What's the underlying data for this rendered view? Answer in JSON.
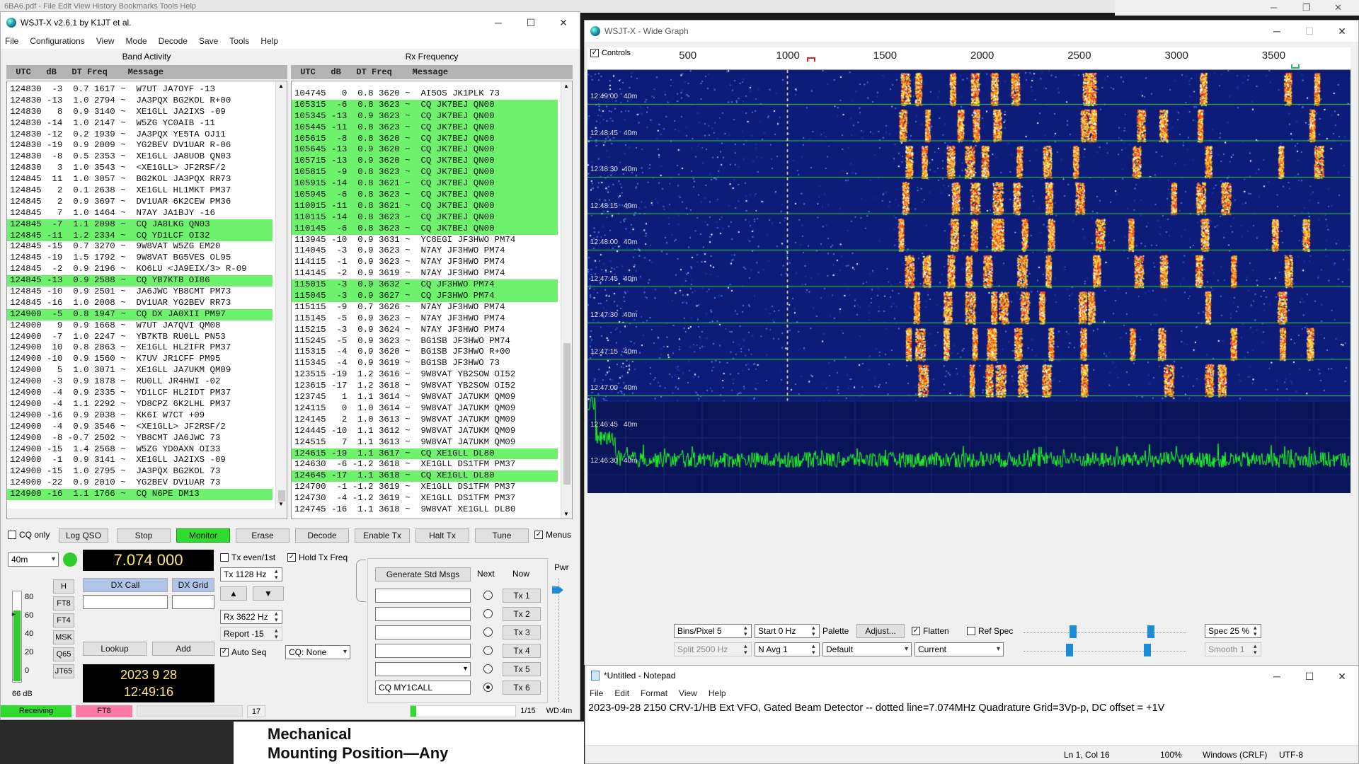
{
  "background_window": {
    "title": "6BA6.pdf - File  Edit  View  History  Bookmarks  Tools  Help"
  },
  "pdf": {
    "line1": "Mechanical",
    "line2": "Mounting Position—Any"
  },
  "main": {
    "title": "WSJT-X   v2.6.1   by K1JT et al.",
    "menus": [
      "File",
      "Configurations",
      "View",
      "Mode",
      "Decode",
      "Save",
      "Tools",
      "Help"
    ],
    "band_activity_title": "Band Activity",
    "rx_frequency_title": "Rx Frequency",
    "list_header": " UTC   dB   DT Freq    Message",
    "band_rows": [
      {
        "t": "124830  -3  0.7 1617 ~  W7UT JA7OYF -13",
        "hl": false
      },
      {
        "t": "124830 -13  1.0 2794 ~  JA3PQX BG2KOL R+00",
        "hl": false
      },
      {
        "t": "124830   8  0.9 3140 ~  XE1GLL JA2IXS -09",
        "hl": false
      },
      {
        "t": "124830 -14  1.0 2147 ~  W5ZG YC0AIB -11",
        "hl": false
      },
      {
        "t": "124830 -12  0.2 1939 ~  JA3PQX YE5TA OJ11",
        "hl": false
      },
      {
        "t": "124830 -19  0.9 2009 ~  YG2BEV DV1UAR R-06",
        "hl": false
      },
      {
        "t": "124830  -8  0.5 2353 ~  XE1GLL JA8UOB QN03",
        "hl": false
      },
      {
        "t": "124830   3  1.0 3543 ~  <XE1GLL> JF2RSF/2",
        "hl": false
      },
      {
        "t": "124845  11  1.0 3057 ~  BG2KOL JA3PQX RR73",
        "hl": false
      },
      {
        "t": "124845   2  0.1 2638 ~  XE1GLL HL1MKT PM37",
        "hl": false
      },
      {
        "t": "124845   2  0.9 3697 ~  DV1UAR 6K2CEW PM36",
        "hl": false
      },
      {
        "t": "124845   7  1.0 1464 ~  N7AY JA1BJY -16",
        "hl": false
      },
      {
        "t": "124845  -7  1.1 2098 ~  CQ JA8LKG QN03",
        "hl": true
      },
      {
        "t": "124845 -11  1.2 2334 ~  CQ YD1LCF OI32",
        "hl": true
      },
      {
        "t": "124845 -15  0.7 3270 ~  9W8VAT W5ZG EM20",
        "hl": false
      },
      {
        "t": "124845 -19  1.5 1792 ~  9W8VAT BG5VES OL95",
        "hl": false
      },
      {
        "t": "124845  -2  0.9 2196 ~  KO6LU <JA9EIX/3> R-09",
        "hl": false
      },
      {
        "t": "124845 -13  0.9 2588 ~  CQ YB7KTB OI86",
        "hl": true
      },
      {
        "t": "124845 -10  0.9 2501 ~  JA6JWC YB8CMT PM73",
        "hl": false
      },
      {
        "t": "124845 -16  1.0 2008 ~  DV1UAR YG2BEV RR73",
        "hl": false
      },
      {
        "t": "124900  -5  0.8 1947 ~  CQ DX JA0XII PM97",
        "hl": true
      },
      {
        "t": "124900   9  0.9 1668 ~  W7UT JA7QVI QM08",
        "hl": false
      },
      {
        "t": "124900  -7  1.0 2247 ~  YB7KTB RU0LL PN53",
        "hl": false
      },
      {
        "t": "124900  10  0.8 2863 ~  XE1GLL HL2IFR PM37",
        "hl": false
      },
      {
        "t": "124900 -10  0.9 1560 ~  K7UV JR1CFF PM95",
        "hl": false
      },
      {
        "t": "124900   5  1.0 3071 ~  XE1GLL JA7UKM QM09",
        "hl": false
      },
      {
        "t": "124900  -3  0.9 1878 ~  RU0LL JR4HWI -02",
        "hl": false
      },
      {
        "t": "124900  -4  0.9 2335 ~  YD1LCF HL2IDT PM37",
        "hl": false
      },
      {
        "t": "124900  -4  1.1 2292 ~  YD8CPZ 6K2LHL PM37",
        "hl": false
      },
      {
        "t": "124900 -16  0.9 2038 ~  KK6I W7CT +09",
        "hl": false
      },
      {
        "t": "124900  -4  0.9 3546 ~  <XE1GLL> JF2RSF/2",
        "hl": false
      },
      {
        "t": "124900  -8 -0.7 2502 ~  YB8CMT JA6JWC 73",
        "hl": false
      },
      {
        "t": "124900 -15  1.4 2568 ~  W5ZG YD0AXN OI33",
        "hl": false
      },
      {
        "t": "124900  -1  0.9 3141 ~  XE1GLL JA2IXS -09",
        "hl": false
      },
      {
        "t": "124900 -15  1.0 2795 ~  JA3PQX BG2KOL 73",
        "hl": false
      },
      {
        "t": "124900 -22  0.9 2010 ~  YG2BEV DV1UAR 73",
        "hl": false
      },
      {
        "t": "124900 -16  1.1 1766 ~  CQ N6PE DM13",
        "hl": true
      }
    ],
    "rx_rows": [
      {
        "t": "104745   0  0.8 3620 ~  AI5OS JK1PLK 73",
        "hl": false
      },
      {
        "t": "105315  -6  0.8 3623 ~  CQ JK7BEJ QN00",
        "hl": true
      },
      {
        "t": "105345 -13  0.9 3623 ~  CQ JK7BEJ QN00",
        "hl": true
      },
      {
        "t": "105445 -11  0.8 3623 ~  CQ JK7BEJ QN00",
        "hl": true
      },
      {
        "t": "105615  -8  0.8 3620 ~  CQ JK7BEJ QN00",
        "hl": true
      },
      {
        "t": "105645 -13  0.9 3620 ~  CQ JK7BEJ QN00",
        "hl": true
      },
      {
        "t": "105715 -13  0.9 3620 ~  CQ JK7BEJ QN00",
        "hl": true
      },
      {
        "t": "105815  -9  0.8 3623 ~  CQ JK7BEJ QN00",
        "hl": true
      },
      {
        "t": "105915 -14  0.8 3621 ~  CQ JK7BEJ QN00",
        "hl": true
      },
      {
        "t": "105945  -6  0.8 3623 ~  CQ JK7BEJ QN00",
        "hl": true
      },
      {
        "t": "110015 -11  0.8 3621 ~  CQ JK7BEJ QN00",
        "hl": true
      },
      {
        "t": "110115 -14  0.8 3623 ~  CQ JK7BEJ QN00",
        "hl": true
      },
      {
        "t": "110145  -6  0.8 3623 ~  CQ JK7BEJ QN00",
        "hl": true
      },
      {
        "t": "113945 -10  0.9 3631 ~  YC8EGI JF3HWO PM74",
        "hl": false
      },
      {
        "t": "114045  -3  0.9 3623 ~  N7AY JF3HWO PM74",
        "hl": false
      },
      {
        "t": "114115  -1  0.9 3623 ~  N7AY JF3HWO PM74",
        "hl": false
      },
      {
        "t": "114145  -2  0.9 3619 ~  N7AY JF3HWO PM74",
        "hl": false
      },
      {
        "t": "115015  -3  0.9 3632 ~  CQ JF3HWO PM74",
        "hl": true
      },
      {
        "t": "115045  -3  0.9 3627 ~  CQ JF3HWO PM74",
        "hl": true
      },
      {
        "t": "115115  -9  0.7 3626 ~  N7AY JF3HWO PM74",
        "hl": false
      },
      {
        "t": "115145  -5  0.9 3623 ~  N7AY JF3HWO PM74",
        "hl": false
      },
      {
        "t": "115215  -3  0.9 3624 ~  N7AY JF3HWO PM74",
        "hl": false
      },
      {
        "t": "115245  -5  0.9 3623 ~  BG1SB JF3HWO PM74",
        "hl": false
      },
      {
        "t": "115315  -4  0.9 3620 ~  BG1SB JF3HWO R+00",
        "hl": false
      },
      {
        "t": "115345  -4  0.9 3619 ~  BG1SB JF3HWO 73",
        "hl": false
      },
      {
        "t": "123515 -19  1.2 3616 ~  9W8VAT YB2SOW OI52",
        "hl": false
      },
      {
        "t": "123615 -17  1.2 3618 ~  9W8VAT YB2SOW OI52",
        "hl": false
      },
      {
        "t": "123745   1  1.1 3614 ~  9W8VAT JA7UKM QM09",
        "hl": false
      },
      {
        "t": "124115   0  1.0 3614 ~  9W8VAT JA7UKM QM09",
        "hl": false
      },
      {
        "t": "124145   2  1.0 3613 ~  9W8VAT JA7UKM QM09",
        "hl": false
      },
      {
        "t": "124445 -10  1.1 3612 ~  9W8VAT JA7UKM QM09",
        "hl": false
      },
      {
        "t": "124515   7  1.1 3613 ~  9W8VAT JA7UKM QM09",
        "hl": false
      },
      {
        "t": "124615 -19  1.1 3617 ~  CQ XE1GLL DL80",
        "hl": true
      },
      {
        "t": "124630  -6 -1.2 3618 ~  XE1GLL DS1TFM PM37",
        "hl": false
      },
      {
        "t": "124645 -17  1.1 3618 ~  CQ XE1GLL DL80",
        "hl": true
      },
      {
        "t": "124700  -1 -1.2 3619 ~  XE1GLL DS1TFM PM37",
        "hl": false
      },
      {
        "t": "124730  -4 -1.2 3619 ~  XE1GLL DS1TFM PM37",
        "hl": false
      },
      {
        "t": "124745 -16  1.1 3618 ~  9W8VAT XE1GLL DL80",
        "hl": false
      }
    ],
    "buttons": {
      "cq_only": "CQ only",
      "log_qso": "Log QSO",
      "stop": "Stop",
      "monitor": "Monitor",
      "erase": "Erase",
      "decode": "Decode",
      "enable_tx": "Enable Tx",
      "halt_tx": "Halt Tx",
      "tune": "Tune",
      "menus": "Menus"
    },
    "band": "40m",
    "dial_freq": "7.074 000",
    "tx_even": "Tx even/1st",
    "hold_tx": "Hold Tx Freq",
    "tx_freq": "Tx  1128  Hz",
    "rx_freq": "Rx  3622  Hz",
    "report": "Report -15",
    "auto_seq": "Auto Seq",
    "cq_none": "CQ: None",
    "dx_call": "DX Call",
    "dx_grid": "DX Grid",
    "lookup": "Lookup",
    "add": "Add",
    "mode_btns": [
      "H",
      "FT8",
      "FT4",
      "MSK",
      "Q65",
      "JT65"
    ],
    "meter_labels": [
      "80",
      "60",
      "40",
      "20",
      "0"
    ],
    "meter_db": "66 dB",
    "date": "2023 9 28",
    "time": "12:49:16",
    "gen_std": "Generate Std Msgs",
    "next": "Next",
    "now": "Now",
    "tx_btns": [
      "Tx 1",
      "Tx 2",
      "Tx 3",
      "Tx 4",
      "Tx 5",
      "Tx 6"
    ],
    "tx6_msg": "CQ MY1CALL",
    "pwr": "Pwr",
    "status": {
      "receiving": "Receiving",
      "mode": "FT8",
      "count": "17",
      "page": "1/15",
      "wd": "WD:4m"
    }
  },
  "wide": {
    "title": "WSJT-X - Wide Graph",
    "controls": "Controls",
    "ticks": [
      "500",
      "1000",
      "1500",
      "2000",
      "2500",
      "3000",
      "3500"
    ],
    "time_labels": [
      "12:49:00",
      "12:48:45",
      "12:48:30",
      "12:48:15",
      "12:48:00",
      "12:47:45",
      "12:47:30",
      "12:47:15",
      "12:47:00",
      "12:46:45",
      "12:46:30"
    ],
    "band_tag": "40m",
    "bins": "Bins/Pixel  5",
    "start": "Start  0 Hz",
    "palette": "Palette",
    "adjust": "Adjust...",
    "flatten": "Flatten",
    "ref_spec": "Ref Spec",
    "spec": "Spec  25 %",
    "split": "Split   2500  Hz",
    "navg": "N Avg  1",
    "default": "Default",
    "current": "Current",
    "smooth": "Smooth   1"
  },
  "notepad": {
    "title": "*Untitled - Notepad",
    "menus": [
      "File",
      "Edit",
      "Format",
      "View",
      "Help"
    ],
    "text": "2023-09-28 2150 CRV-1/HB Ext VFO, Gated Beam Detector  -- dotted line=7.074MHz  Quadrature Grid=3Vp-p, DC offset = +1V",
    "pos": "Ln 1, Col 16",
    "zoom": "100%",
    "eol": "Windows (CRLF)",
    "enc": "UTF-8"
  }
}
